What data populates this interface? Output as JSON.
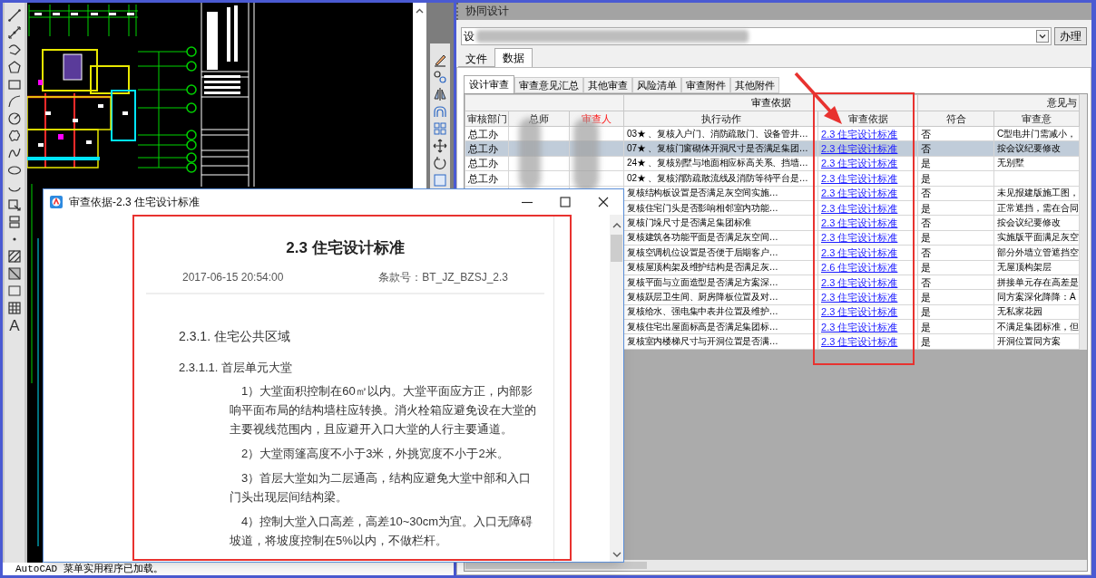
{
  "cad": {
    "command_line": "AutoCAD 菜单实用程序已加载。",
    "text_tool": "A"
  },
  "panel": {
    "title": "协同设计",
    "combo_value": "设",
    "action_button": "办理",
    "tabs": [
      {
        "label": "文件",
        "selected": false
      },
      {
        "label": "数据",
        "selected": true
      }
    ],
    "subtabs": [
      {
        "label": "设计审查",
        "selected": true
      },
      {
        "label": "审查意见汇总",
        "selected": false
      },
      {
        "label": "其他审查",
        "selected": false
      },
      {
        "label": "风险清单",
        "selected": false
      },
      {
        "label": "审查附件",
        "selected": false
      },
      {
        "label": "其他附件",
        "selected": false
      }
    ],
    "table": {
      "group_headers": [
        "审查依据",
        "意见与"
      ],
      "columns": [
        {
          "label": "审核部门",
          "highlighted": false
        },
        {
          "label": "总师",
          "highlighted": false
        },
        {
          "label": "审查人",
          "highlighted": true
        },
        {
          "label": "执行动作",
          "highlighted": false
        },
        {
          "label": "审查依据",
          "highlighted": false
        },
        {
          "label": "符合",
          "highlighted": false
        },
        {
          "label": "审查意",
          "highlighted": false
        }
      ],
      "rows": [
        {
          "department": "总工办",
          "action": "03★ 、复核入户门、消防疏散门、设备管井…",
          "basis": "2.3 住宅设计标准",
          "conforms": "否",
          "opinion": "C型电井门需减小，",
          "selected": false
        },
        {
          "department": "总工办",
          "action": "07★ 、复核门窗砌体开洞尺寸是否满足集团…",
          "basis": "2.3 住宅设计标准",
          "conforms": "否",
          "opinion": "按会议纪要修改",
          "selected": true
        },
        {
          "department": "总工办",
          "action": "24★ 、复核别墅与地面相应标高关系、挡墙…",
          "basis": "2.3 住宅设计标准",
          "conforms": "是",
          "opinion": "无别墅",
          "selected": false
        },
        {
          "department": "总工办",
          "action": "02★ 、复核消防疏散流线及消防等待平台是…",
          "basis": "2.3 住宅设计标准",
          "conforms": "是",
          "selected": false
        },
        {
          "action": "复核结构板设置是否满足灰空间实施…",
          "basis": "2.3 住宅设计标准",
          "conforms": "否",
          "opinion": "未见报建版施工图，",
          "selected": false
        },
        {
          "action": "复核住宅门头是否影响相邻室内功能…",
          "basis": "2.3 住宅设计标准",
          "conforms": "是",
          "opinion": "正常遮挡，需在合同",
          "selected": false
        },
        {
          "action": "复核门垛尺寸是否满足集团标准",
          "basis": "2.3 住宅设计标准",
          "conforms": "否",
          "opinion": "按会议纪要修改",
          "selected": false
        },
        {
          "action": "复核建筑各功能平面是否满足灰空间…",
          "basis": "2.3 住宅设计标准",
          "conforms": "是",
          "opinion": "实施版平面满足灰空",
          "selected": false
        },
        {
          "action": "复核空调机位设置是否便于后期客户…",
          "basis": "2.3 住宅设计标准",
          "conforms": "否",
          "opinion": "部分外墙立管遮挡空",
          "selected": false
        },
        {
          "action": "复核屋顶构架及维护结构是否满足灰…",
          "basis": "2.6 住宅设计标准",
          "conforms": "是",
          "opinion": "无屋顶构架层",
          "selected": false
        },
        {
          "action": "复核平面与立面造型是否满足方案深…",
          "basis": "2.3 住宅设计标准",
          "conforms": "否",
          "opinion": "拼接单元存在高差是",
          "selected": false
        },
        {
          "action": "复核跃层卫生间、厨房降板位置及对…",
          "basis": "2.3 住宅设计标准",
          "conforms": "是",
          "opinion": "同方案深化降降：A",
          "selected": false
        },
        {
          "action": "复核给水、强电集中表井位置及维护…",
          "basis": "2.3 住宅设计标准",
          "conforms": "是",
          "opinion": "无私家花园",
          "selected": false
        },
        {
          "action": "复核住宅出屋面标高是否满足集团标…",
          "basis": "2.3 住宅设计标准",
          "conforms": "是",
          "opinion": "不满足集团标准，但",
          "selected": false
        },
        {
          "action": "复核室内楼梯尺寸与开洞位置是否满…",
          "basis": "2.3 住宅设计标准",
          "conforms": "是",
          "opinion": "开洞位置同方案",
          "selected": false
        }
      ]
    }
  },
  "popup": {
    "title": "审查依据-2.3 住宅设计标准",
    "article": {
      "heading": "2.3 住宅设计标准",
      "date": "2017-06-15 20:54:00",
      "clause": "条款号：BT_JZ_BZSJ_2.3",
      "sections": [
        {
          "kind": "heading",
          "text": "2.3.1. 住宅公共区域"
        },
        {
          "kind": "subheading",
          "text": "2.3.1.1. 首层单元大堂"
        },
        {
          "kind": "paragraph",
          "text": "1）大堂面积控制在60㎡以内。大堂平面应方正，内部影响平面布局的结构墙柱应转换。消火栓箱应避免设在大堂的主要视线范围内，且应避开入口大堂的人行主要通道。"
        },
        {
          "kind": "paragraph",
          "text": "2）大堂雨篷高度不小于3米，外挑宽度不小于2米。"
        },
        {
          "kind": "paragraph",
          "text": "3）首层大堂如为二层通高，结构应避免大堂中部和入口门头出现层间结构梁。"
        },
        {
          "kind": "paragraph",
          "text": "4）控制大堂入口高差，高差10~30cm为宜。入口无障碍坡道，将坡度控制在5%以内，不做栏杆。"
        }
      ]
    }
  }
}
